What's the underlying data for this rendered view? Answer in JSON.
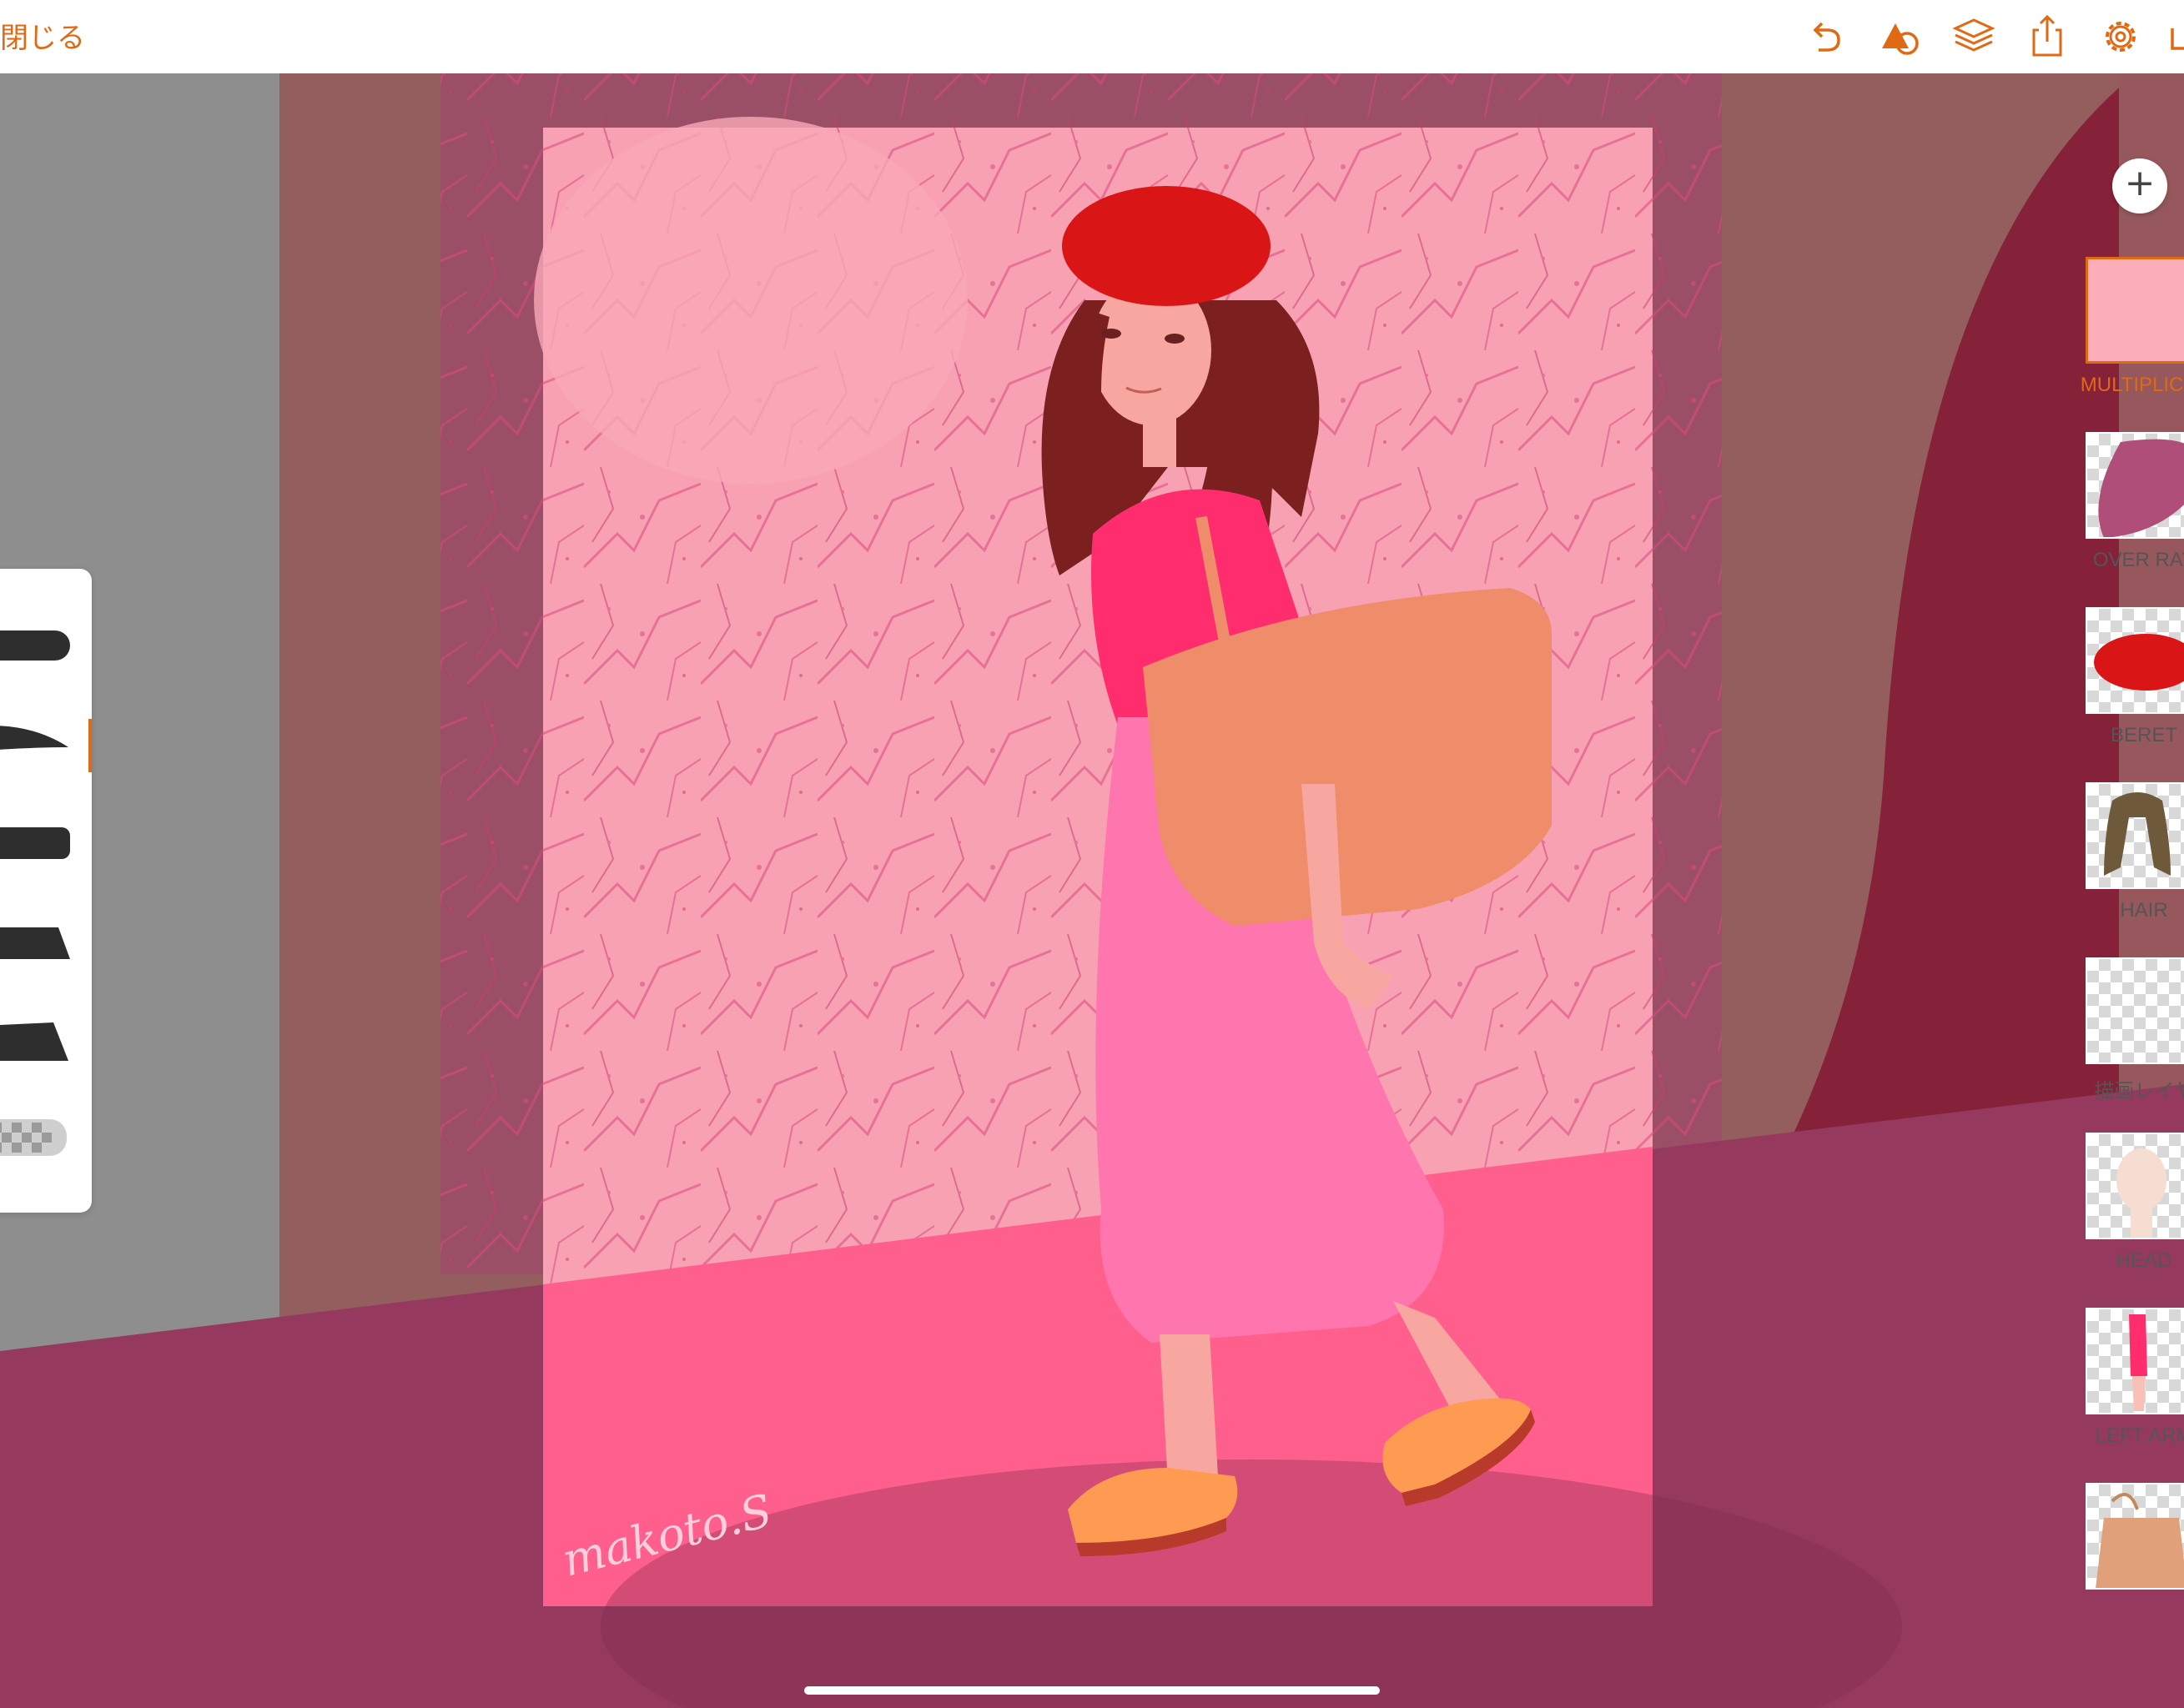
{
  "toolbar": {
    "close_label": "閉じる",
    "icons": [
      "undo-icon",
      "shapes-icon",
      "layers-icon",
      "share-icon",
      "settings-icon",
      "more-icon"
    ],
    "accent": "#e06a14"
  },
  "canvas": {
    "signature": "makoto.S",
    "background_color": "#f7a1b3"
  },
  "brush_panel": {
    "brushes": [
      "round-brush",
      "taper-brush",
      "flat-brush",
      "wedge-brush",
      "slant-brush",
      "texture-brush"
    ],
    "selected_index": 1
  },
  "layers": {
    "add_button": "+",
    "items": [
      {
        "label": "MULTIPLICAT",
        "selected": true
      },
      {
        "label": "OVER RAY",
        "selected": false
      },
      {
        "label": "BERET",
        "selected": false
      },
      {
        "label": "HAIR",
        "selected": false
      },
      {
        "label": "描画レイヤ",
        "selected": false
      },
      {
        "label": "HEAD",
        "selected": false
      },
      {
        "label": "LEFT ARM",
        "selected": false
      },
      {
        "label": "",
        "selected": false
      }
    ]
  }
}
